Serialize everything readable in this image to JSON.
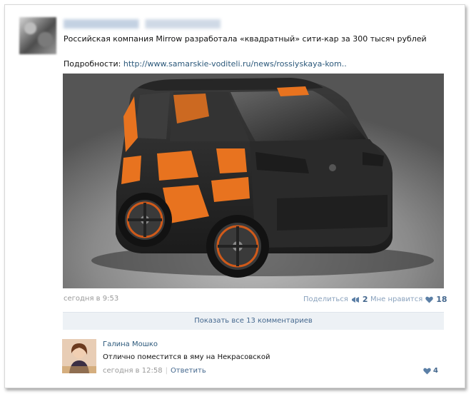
{
  "post": {
    "text": "Российская компания Mirrow разработала «квадратный» сити-кар за 300 тысяч рублей",
    "details_label": "Подробности: ",
    "details_link": "http://www.samarskie-voditeli.ru/news/rossiyskaya-kom..",
    "time": "сегодня в 9:53",
    "share_label": "Поделиться",
    "share_count": "2",
    "likes_label": "Мне нравится",
    "likes_count": "18",
    "show_comments": "Показать все 13 комментариев"
  },
  "comment": {
    "author": "Галина Мошко",
    "text": "Отлично поместится в яму на Некрасовской",
    "time": "сегодня в 12:58",
    "separator": "|",
    "reply_label": "Ответить",
    "likes": "4"
  },
  "colors": {
    "link": "#2b587a",
    "accent": "#45688e",
    "muted": "#999999",
    "car_orange": "#e8731f",
    "car_body": "#2a2a2a"
  },
  "icons": {
    "share": "megaphone-icon",
    "like": "heart-icon"
  }
}
